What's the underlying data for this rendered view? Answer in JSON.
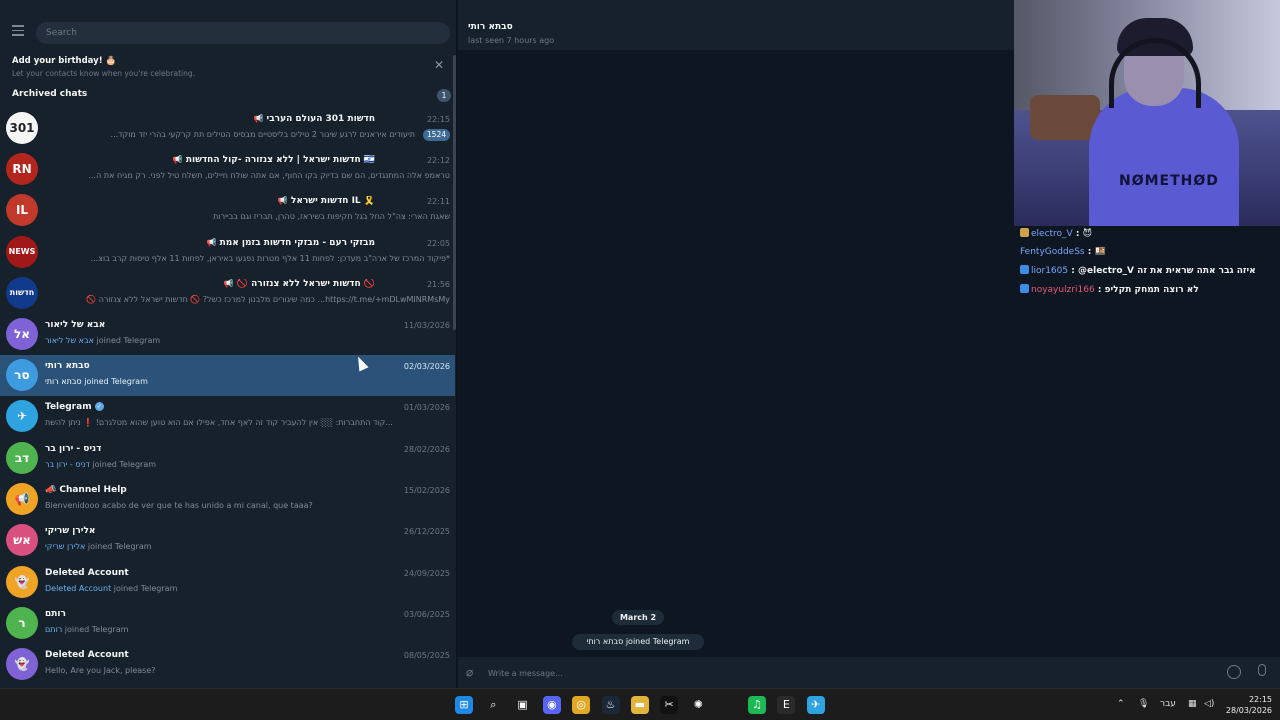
{
  "left_pane": {
    "search_placeholder": "Search",
    "birthday_banner": {
      "title": "Add your birthday! 🎂",
      "subtitle": "Let your contacts know when you're celebrating."
    },
    "archived": {
      "label": "Archived chats",
      "count": "1"
    },
    "chats": [
      {
        "avatar_text": "301",
        "avatar_color": "#f5f5f5",
        "title": "חדשות 301 העולם הערבי",
        "time": "22:15",
        "preview": "תיעודים איראנים לרגע שיגור 2 טילים בליסטיים מבסיס הטילים תת קרקעי בהרי יזד מוקד...",
        "unread": "1524",
        "channel": true,
        "rtl_title": true
      },
      {
        "avatar_text": "RN",
        "avatar_color": "#b3261e",
        "title": "חדשות ישראל | ללא צנזורה -קול החדשות 🇮🇱",
        "time": "22:12",
        "preview": "טראמפ אלה המתנגדים, הם שם בדיוק בקו החוף, אם אתה שולח חיילים, תשלח טיל לפני. רק מגיח את ה...",
        "channel": true,
        "rtl_title": true
      },
      {
        "avatar_text": "IL",
        "avatar_color": "#c0392b",
        "title": "חדשות ישראל IL 🎗️",
        "time": "22:11",
        "preview": "שאגת הארי: צה\"ל החל בגל תקיפות בשיראז, טהרן, תבריז וגם בביירות",
        "channel": true,
        "rtl_title": true
      },
      {
        "avatar_text": "NEWS",
        "avatar_color": "#a01818",
        "title": "מבזקי רעם - מבזקי חדשות בזמן אמת",
        "time": "22:05",
        "preview": "*פיקוד המרכז של ארה\"ב מעדכן: לפחות 11 אלף מטרות נפגעו באיראן, לפחות 11 אלף טיסות קרב בוצ...",
        "channel": true,
        "rtl_title": true
      },
      {
        "avatar_text": "חדשות",
        "avatar_color": "#123a8c",
        "title": "🚫 חדשות ישראל ללא צנזורה 🚫",
        "time": "21:56",
        "preview": "https://t.me/+mDLwMINRMsMy... כמה שיגורים מלבנון למרכז כשל? 🚫 חדשות ישראל ללא צנזורה 🚫",
        "channel": true,
        "rtl_title": true
      },
      {
        "avatar_text": "אל",
        "avatar_color": "#7e62d6",
        "title": "אבא של ליאור",
        "time": "11/03/2026",
        "preview_hl": "אבא של ליאור",
        "preview": " joined Telegram",
        "rtl_title": false
      },
      {
        "avatar_text": "סר",
        "avatar_color": "#3f9be0",
        "title": "סבתא רותי",
        "time": "02/03/2026",
        "preview_hl": "סבתא רותי",
        "preview": " joined Telegram",
        "active": true,
        "rtl_title": false
      },
      {
        "avatar_text": "✈",
        "avatar_color": "#2fa3df",
        "title": "Telegram",
        "time": "01/03/2026",
        "preview": "קוד התחברות: ░░ אין להעביר קוד זה לאף אחד, אפילו אם הוא טוען שהוא מטלגרם! ❗ ניתן להשת...",
        "verified": true,
        "rtl_title": false
      },
      {
        "avatar_text": "דב",
        "avatar_color": "#4fb34f",
        "title": "דניס - ירון בר",
        "time": "28/02/2026",
        "preview_hl": "דניס - ירון בר",
        "preview": " joined Telegram",
        "rtl_title": false
      },
      {
        "avatar_text": "📢",
        "avatar_color": "#f0a425",
        "title": "📣 Channel Help",
        "time": "15/02/2026",
        "preview": "Bienvenidooo acabo de ver que te has unido a mi canal, que taaa?",
        "rtl_title": false
      },
      {
        "avatar_text": "אש",
        "avatar_color": "#d94f7e",
        "title": "אלירן שריקי",
        "time": "26/12/2025",
        "preview_hl": "אלירן שריקי",
        "preview": " joined Telegram",
        "rtl_title": false
      },
      {
        "avatar_text": "👻",
        "avatar_color": "#f0a425",
        "title": "Deleted Account",
        "time": "24/09/2025",
        "preview_hl": "Deleted Account",
        "preview": " joined Telegram",
        "rtl_title": false
      },
      {
        "avatar_text": "ר",
        "avatar_color": "#4fb34f",
        "title": "רותם",
        "time": "03/06/2025",
        "preview_hl": "רותם",
        "preview": " joined Telegram",
        "rtl_title": false
      },
      {
        "avatar_text": "👻",
        "avatar_color": "#7e62d6",
        "title": "Deleted Account",
        "time": "08/05/2025",
        "preview": "Hello, Are you Jack, please?",
        "rtl_title": false
      }
    ]
  },
  "chat_view": {
    "name": "סבתא רותי",
    "status": "last seen 7 hours ago",
    "date_label": "March 2",
    "service_message": "סבתא רותי joined Telegram",
    "compose_placeholder": "Write a message..."
  },
  "webcam": {
    "hoodie_text": "NØMETHØD"
  },
  "stream_chat": [
    {
      "user": "electro_V",
      "user_color": "#7aa7ff",
      "message": "😈",
      "badge_color": "#cfa34b"
    },
    {
      "user": "FentyGoddeSs",
      "user_color": "#7aa7ff",
      "message": "🍱",
      "badge_color": ""
    },
    {
      "user": "lior1605",
      "user_color": "#7aa7ff",
      "message": "@electro_V איזה גבר אתה שראית את זה",
      "badge_color": "#3c8de6"
    },
    {
      "user": "noyayulzri166",
      "user_color": "#e05a7a",
      "message": "לא רוצה תמחק תקליפ",
      "badge_color": "#3c8de6"
    }
  ],
  "taskbar": {
    "icons": [
      "windows-start",
      "search",
      "task-view",
      "discord",
      "chrome",
      "steam",
      "file-explorer",
      "capcut",
      "chatgpt",
      "blank",
      "spotify",
      "epic-games",
      "telegram"
    ],
    "language": "עבר",
    "time": "22:15",
    "date": "28/03/2026"
  },
  "colors": {
    "active_chat": "#2b5278",
    "link_blue": "#6ab2f2",
    "unread_badge": "#3e6a94"
  }
}
